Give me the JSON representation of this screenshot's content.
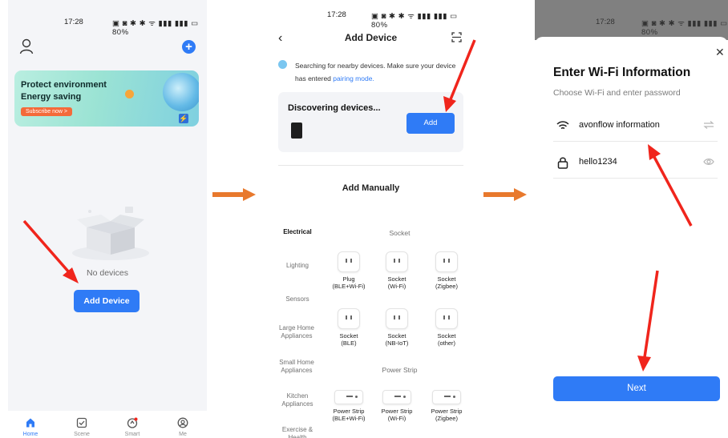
{
  "screen1": {
    "status": {
      "time": "17:28",
      "icons": "▣ ◙ ✱ ✱ ᯤ ▮▮▮ ▮▮▮ ▭ 80%"
    },
    "banner": {
      "line1": "Protect environment",
      "line2": "Energy saving",
      "button": "Subscribe now >"
    },
    "empty_text": "No devices",
    "add_device_button": "Add Device",
    "tabs": [
      {
        "label": "Home",
        "icon": "home-icon",
        "active": true
      },
      {
        "label": "Scene",
        "icon": "checkbox-icon",
        "active": false
      },
      {
        "label": "Smart",
        "icon": "smart-icon",
        "active": false
      },
      {
        "label": "Me",
        "icon": "user-icon",
        "active": false
      }
    ]
  },
  "screen2": {
    "status": {
      "time": "17:28",
      "icons": "▣ ◙ ✱ ✱ ᯤ ▮▮▮ ▮▮▮ ▭ 80%"
    },
    "title": "Add Device",
    "hint": "Searching for nearby devices. Make sure your device has entered",
    "hint_link": "pairing mode.",
    "discovering": "Discovering devices...",
    "add_button": "Add",
    "add_manually": "Add Manually",
    "categories": [
      "Electrical",
      "Lighting",
      "Sensors",
      "Large Home Appliances",
      "Small Home Appliances",
      "Kitchen Appliances",
      "Exercise & Health"
    ],
    "sections": {
      "socket": "Socket",
      "power_strip": "Power Strip"
    },
    "socket_devices": [
      {
        "name": "Plug",
        "sub": "(BLE+Wi-Fi)"
      },
      {
        "name": "Socket",
        "sub": "(Wi-Fi)"
      },
      {
        "name": "Socket",
        "sub": "(Zigbee)"
      },
      {
        "name": "Socket",
        "sub": "(BLE)"
      },
      {
        "name": "Socket",
        "sub": "(NB-IoT)"
      },
      {
        "name": "Socket",
        "sub": "(other)"
      }
    ],
    "strip_devices": [
      {
        "name": "Power Strip",
        "sub": "(BLE+Wi-Fi)"
      },
      {
        "name": "Power Strip",
        "sub": "(Wi-Fi)"
      },
      {
        "name": "Power Strip",
        "sub": "(Zigbee)"
      }
    ]
  },
  "screen3": {
    "status": {
      "time": "17:28",
      "icons": "▣ ◙ ✱ ✱ ᯤ ▮▮▮ ▮▮▮ ▭ 80%"
    },
    "title": "Enter Wi-Fi Information",
    "subtitle": "Choose Wi-Fi and enter password",
    "wifi_name": "avonflow information",
    "password": "hello1234",
    "next_button": "Next"
  },
  "colors": {
    "accent": "#2f7bf6",
    "annotation_red": "#f0251c",
    "flow_arrow": "#e8792d"
  }
}
